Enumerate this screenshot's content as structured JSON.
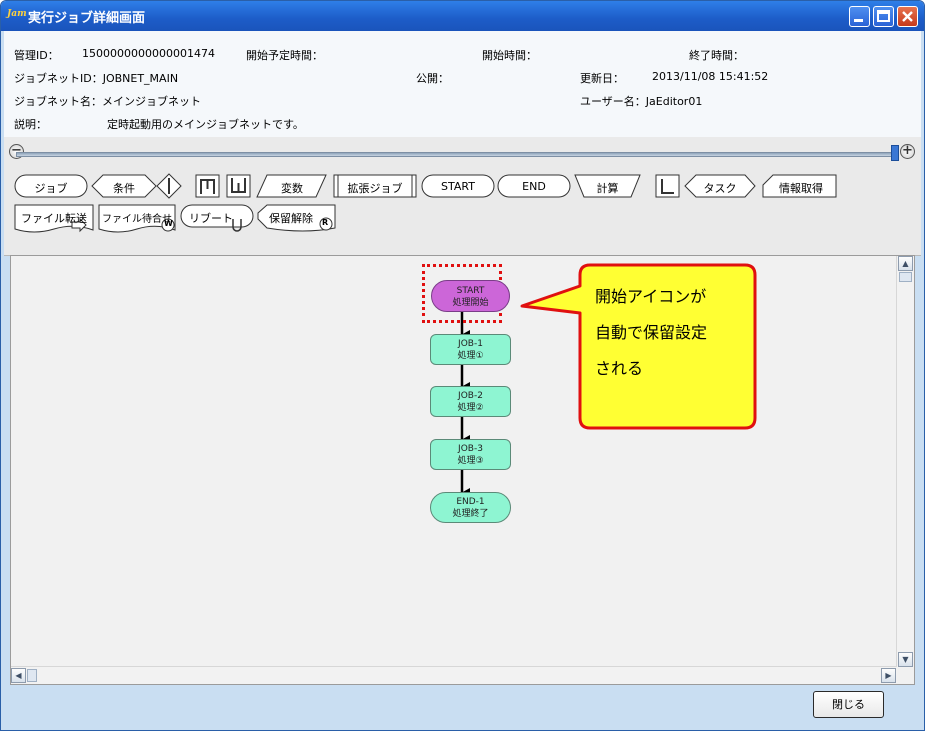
{
  "window": {
    "app_icon_text": "Jam",
    "title": "実行ジョブ詳細画面"
  },
  "info": {
    "manage_id_label": "管理ID：",
    "manage_id_value": "1500000000000001474",
    "scheduled_start_label": "開始予定時間：",
    "start_time_label": "開始時間：",
    "end_time_label": "終了時間：",
    "jobnet_id": "ジョブネットID：JOBNET_MAIN",
    "public_label": "公開：",
    "updated_label": "更新日：",
    "updated_value": "2013/11/08 15:41:52",
    "jobnet_name": "ジョブネット名：メインジョブネット",
    "user_label": "ユーザー名：JaEditor01",
    "description_label": "説明：",
    "description_value": "定時起動用のメインジョブネットです。"
  },
  "zoom": {
    "minus_icon": "zoom-out-icon",
    "plus_icon": "zoom-in-icon",
    "minus_text": "−",
    "plus_text": "+"
  },
  "palette": {
    "job": "ジョブ",
    "condition": "条件",
    "variable": "変数",
    "ext_job": "拡張ジョブ",
    "start": "START",
    "end": "END",
    "calc": "計算",
    "l_icon": "L",
    "task": "タスク",
    "info_get": "情報取得",
    "file_transfer": "ファイル転送",
    "file_wait": "ファイル待合せ",
    "reboot": "リブート",
    "hold_release": "保留解除",
    "w_badge": "W",
    "r_badge": "R"
  },
  "flow": {
    "nodes": [
      {
        "id": "START",
        "label": "処理開始",
        "type": "start",
        "held": true
      },
      {
        "id": "JOB-1",
        "label": "処理①",
        "type": "job"
      },
      {
        "id": "JOB-2",
        "label": "処理②",
        "type": "job"
      },
      {
        "id": "JOB-3",
        "label": "処理③",
        "type": "job"
      },
      {
        "id": "END-1",
        "label": "処理終了",
        "type": "end"
      }
    ],
    "callout": {
      "line1": "開始アイコンが",
      "line2": "自動で保留設定",
      "line3": "される"
    }
  },
  "scroll": {
    "up": "▲",
    "down": "▼",
    "left": "◀",
    "right": "▶"
  },
  "footer": {
    "close_button": "閉じる"
  },
  "colors": {
    "title_bar": "#1d5cc8",
    "start_node": "#cc66d8",
    "job_node": "#8ef5d2",
    "callout_fill": "#ffff33",
    "callout_border": "#e01010",
    "hold_border": "#e01010"
  }
}
